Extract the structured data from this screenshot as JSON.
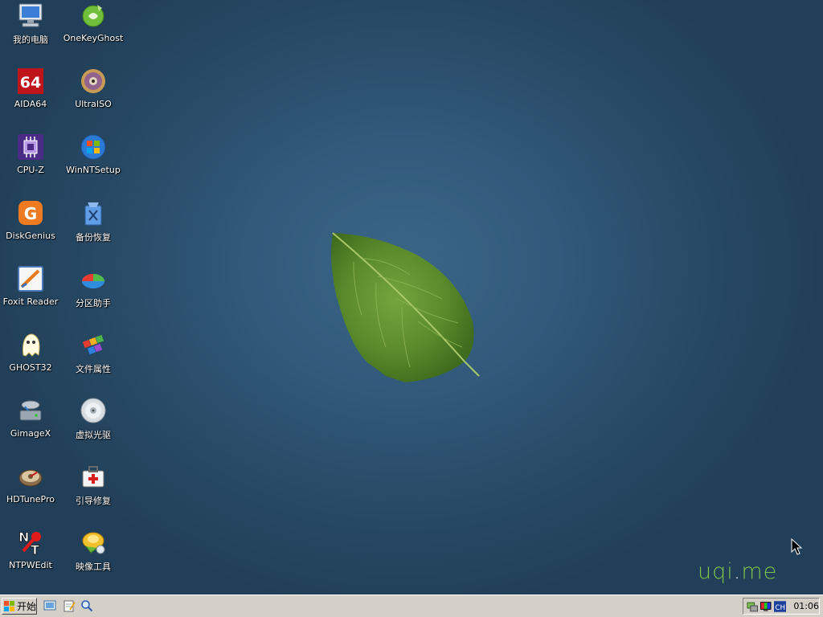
{
  "desktop": {
    "icons": [
      {
        "label": "我的电脑",
        "icon": "computer-icon"
      },
      {
        "label": "OneKeyGhost",
        "icon": "onekeyghost-icon"
      },
      {
        "label": "AIDA64",
        "icon": "aida64-icon"
      },
      {
        "label": "UltraISO",
        "icon": "disc-icon"
      },
      {
        "label": "CPU-Z",
        "icon": "cpu-icon"
      },
      {
        "label": "WinNTSetup",
        "icon": "windows-icon"
      },
      {
        "label": "DiskGenius",
        "icon": "diskgenius-icon"
      },
      {
        "label": "备份恢复",
        "icon": "backup-icon"
      },
      {
        "label": "Foxit Reader",
        "icon": "foxit-icon"
      },
      {
        "label": "分区助手",
        "icon": "partition-icon"
      },
      {
        "label": "GHOST32",
        "icon": "ghost-icon"
      },
      {
        "label": "文件属性",
        "icon": "file-attributes-icon"
      },
      {
        "label": "GimageX",
        "icon": "gimagex-icon"
      },
      {
        "label": "虚拟光驱",
        "icon": "virtual-drive-icon"
      },
      {
        "label": "HDTunePro",
        "icon": "hdtune-icon"
      },
      {
        "label": "引导修复",
        "icon": "boot-repair-icon"
      },
      {
        "label": "NTPWEdit",
        "icon": "ntpwedit-icon"
      },
      {
        "label": "映像工具",
        "icon": "image-tool-icon"
      }
    ],
    "brand": {
      "part1": "uqi",
      "dot": ".",
      "part2": "me"
    }
  },
  "taskbar": {
    "start_label": "开始",
    "quick_launch": [
      "show-desktop-icon",
      "notepad-icon",
      "search-icon"
    ],
    "tray": {
      "icons": [
        "network-icon",
        "display-icon"
      ],
      "ime": "CH",
      "clock": "01:06"
    }
  },
  "colors": {
    "desktop_center": "#3b6687",
    "desktop_edge": "#213f58",
    "taskbar": "#d4d0c8",
    "brand_green": "#7fc44a"
  }
}
